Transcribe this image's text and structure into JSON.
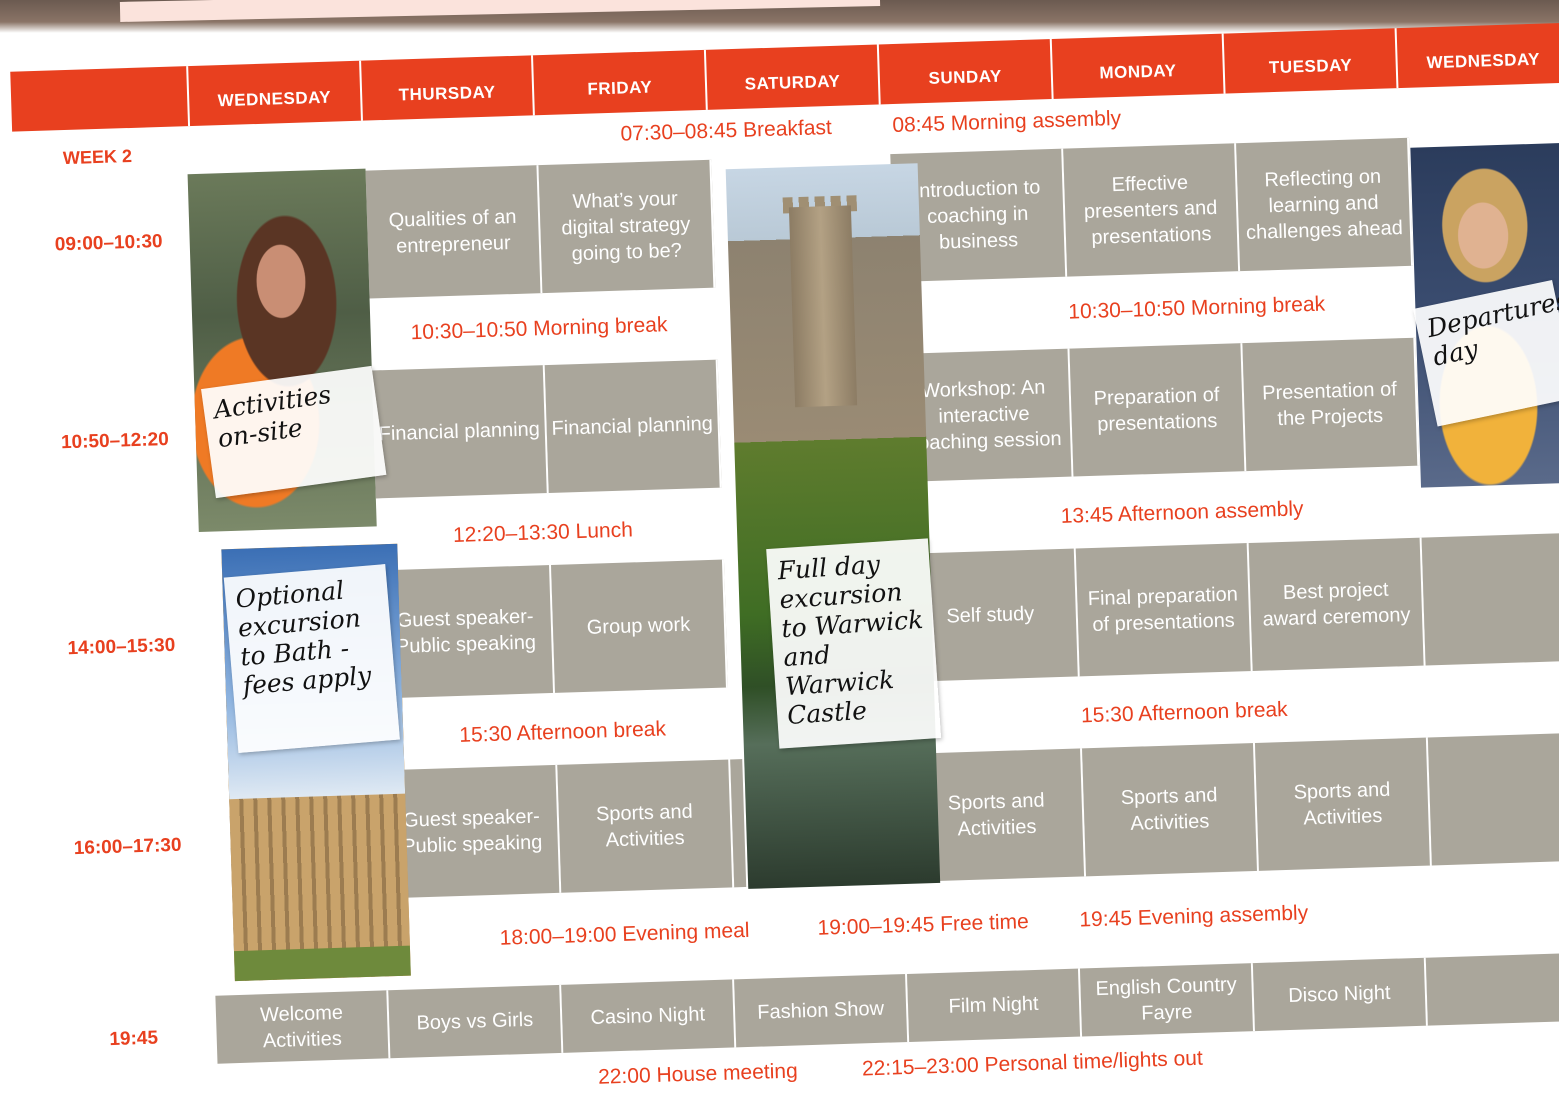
{
  "header": {
    "days": [
      "WEDNESDAY",
      "THURSDAY",
      "FRIDAY",
      "SATURDAY",
      "SUNDAY",
      "MONDAY",
      "TUESDAY",
      "WEDNESDAY"
    ]
  },
  "week_label": "WEEK 2",
  "times": [
    "09:00–10:30",
    "10:50–12:20",
    "14:00–15:30",
    "16:00–17:30",
    "19:45"
  ],
  "bands": {
    "breakfast": "07:30–08:45 Breakfast",
    "morning_assembly": "08:45 Morning assembly",
    "morning_break": "10:30–10:50 Morning break",
    "lunch": "12:20–13:30 Lunch",
    "afternoon_assembly": "13:45 Afternoon assembly",
    "afternoon_break": "15:30 Afternoon break",
    "evening_meal": "18:00–19:00  Evening meal",
    "free_time": "19:00–19:45 Free time",
    "evening_assembly": "19:45 Evening assembly",
    "house_meeting": "22:00 House meeting",
    "lights_out": "22:15–23:00 Personal time/lights out"
  },
  "sessions": {
    "s1": [
      "Qualities of an entrepreneur",
      "What’s your digital strategy going to be?",
      "Introduction to coaching in business",
      "Effective presenters and presentations",
      "Reflecting on learning and challenges ahead"
    ],
    "s2": [
      "Financial planning",
      "Financial planning",
      "Workshop: An interactive coaching session",
      "Preparation of presentations",
      "Presentation of the Projects"
    ],
    "s3": [
      "Guest speaker- Public speaking",
      "Group work",
      "Self study",
      "Final preparation of presentations",
      "Best project award ceremony"
    ],
    "s4": [
      "Guest speaker- Public speaking",
      "Sports and Activities",
      "Sports and Activities",
      "Sports and Activities",
      "Sports and Activities"
    ],
    "evening": [
      "Welcome Activities",
      "Boys vs Girls",
      "Casino Night",
      "Fashion Show",
      "Film Night",
      "English Country Fayre",
      "Disco Night"
    ]
  },
  "notes": {
    "activities": "Activities on-site",
    "bath": "Optional excursion to Bath - fees apply",
    "warwick": "Full day excursion to Warwick and Warwick Castle",
    "departures": "Departures day"
  },
  "colors": {
    "accent": "#e8401f",
    "cell": "#aaa69b"
  }
}
